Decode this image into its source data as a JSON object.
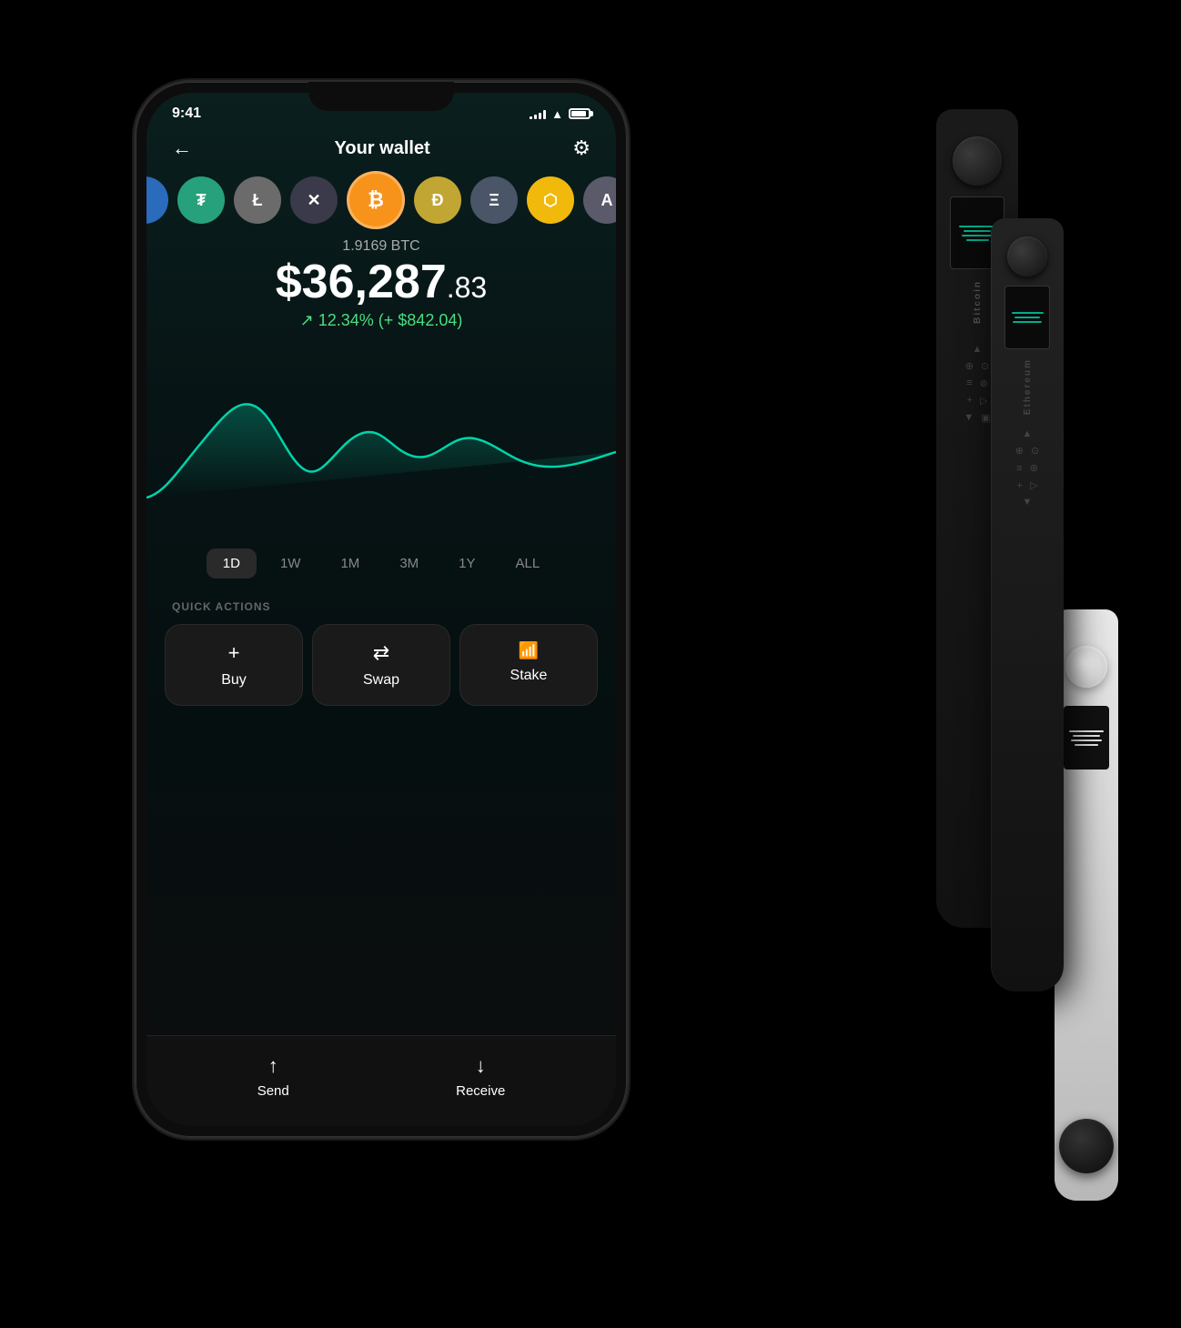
{
  "status": {
    "time": "9:41",
    "signal": [
      3,
      5,
      7,
      9,
      11
    ],
    "wifi": "WiFi",
    "battery": "Battery"
  },
  "header": {
    "back_label": "←",
    "title": "Your wallet",
    "settings_label": "⚙"
  },
  "coins": [
    {
      "id": "partial",
      "symbol": "",
      "class": "coin-partial"
    },
    {
      "id": "tether",
      "symbol": "₮",
      "class": "coin-tether"
    },
    {
      "id": "litecoin",
      "symbol": "Ł",
      "class": "coin-litecoin"
    },
    {
      "id": "xrp",
      "symbol": "✕",
      "class": "coin-xrp"
    },
    {
      "id": "btc",
      "symbol": "₿",
      "class": "coin-btc"
    },
    {
      "id": "doge",
      "symbol": "Ð",
      "class": "coin-doge"
    },
    {
      "id": "eth",
      "symbol": "Ξ",
      "class": "coin-eth"
    },
    {
      "id": "bnb",
      "symbol": "⬡",
      "class": "coin-bnb"
    },
    {
      "id": "algo",
      "symbol": "A",
      "class": "coin-algo"
    }
  ],
  "balance": {
    "amount_label": "1.9169 BTC",
    "main": "$36,287",
    "cents": ".83",
    "change": "↗ 12.34% (+ $842.04)"
  },
  "time_range": {
    "options": [
      "1D",
      "1W",
      "1M",
      "3M",
      "1Y",
      "ALL"
    ],
    "active": "1D"
  },
  "quick_actions": {
    "label": "QUICK ACTIONS",
    "buttons": [
      {
        "id": "buy",
        "icon": "+",
        "label": "Buy"
      },
      {
        "id": "swap",
        "icon": "⇄",
        "label": "Swap"
      },
      {
        "id": "stake",
        "icon": "↑↑",
        "label": "Stake"
      }
    ]
  },
  "bottom_nav": {
    "buttons": [
      {
        "id": "send",
        "icon": "↑",
        "label": "Send"
      },
      {
        "id": "receive",
        "icon": "↓",
        "label": "Receive"
      }
    ]
  },
  "hardware": {
    "black_label": "Bitcoin",
    "front_label": "Ethereum"
  }
}
